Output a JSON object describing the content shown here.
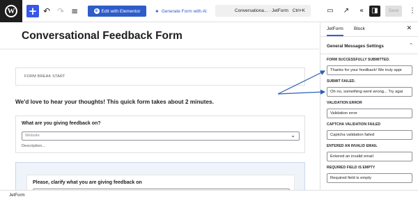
{
  "toolbar": {
    "logo": "W",
    "add": "+",
    "elementor_label": "Edit with Elementor",
    "ai_label": "Generate Form with AI",
    "doc_title": "Conversationa...",
    "doc_suffix": "· JetForm",
    "shortcut": "Ctrl+K",
    "save_label": "Save"
  },
  "page": {
    "title": "Conversational Feedback Form"
  },
  "blocks": {
    "form_break": "FORM BREAK START",
    "intro": "We'd love to hear your thoughts! This quick form takes about 2 minutes.",
    "question_label": "What are you giving feedback on?",
    "question_placeholder": "Website",
    "question_desc": "Description...",
    "clarify_label": "Please, clarify what you are giving feedback on"
  },
  "footer": {
    "breadcrumb": "JetForm"
  },
  "sidebar": {
    "tab_jetform": "JetForm",
    "tab_block": "Block",
    "section_title": "General Messages Settings",
    "fields": [
      {
        "label": "FORM SUCCESSFULLY SUBMITTED.",
        "value": "Thanks for your feedback! We truly appr"
      },
      {
        "label": "SUBMIT FAILED.",
        "value": "Oh no, something went wrong... Try agai"
      },
      {
        "label": "VALIDATION ERROR",
        "value": "Validation error"
      },
      {
        "label": "CAPTCHA VALIDATION FAILED",
        "value": "Captcha validation failed"
      },
      {
        "label": "ENTERED AN INVALID EMAIL",
        "value": "Entered an invalid email"
      },
      {
        "label": "REQUIRED FIELD IS EMPTY",
        "value": "Required field is empty"
      }
    ]
  },
  "colors": {
    "accent": "#3858e9",
    "elementor": "#2e5cc9",
    "arrow": "#2b5fb5"
  }
}
